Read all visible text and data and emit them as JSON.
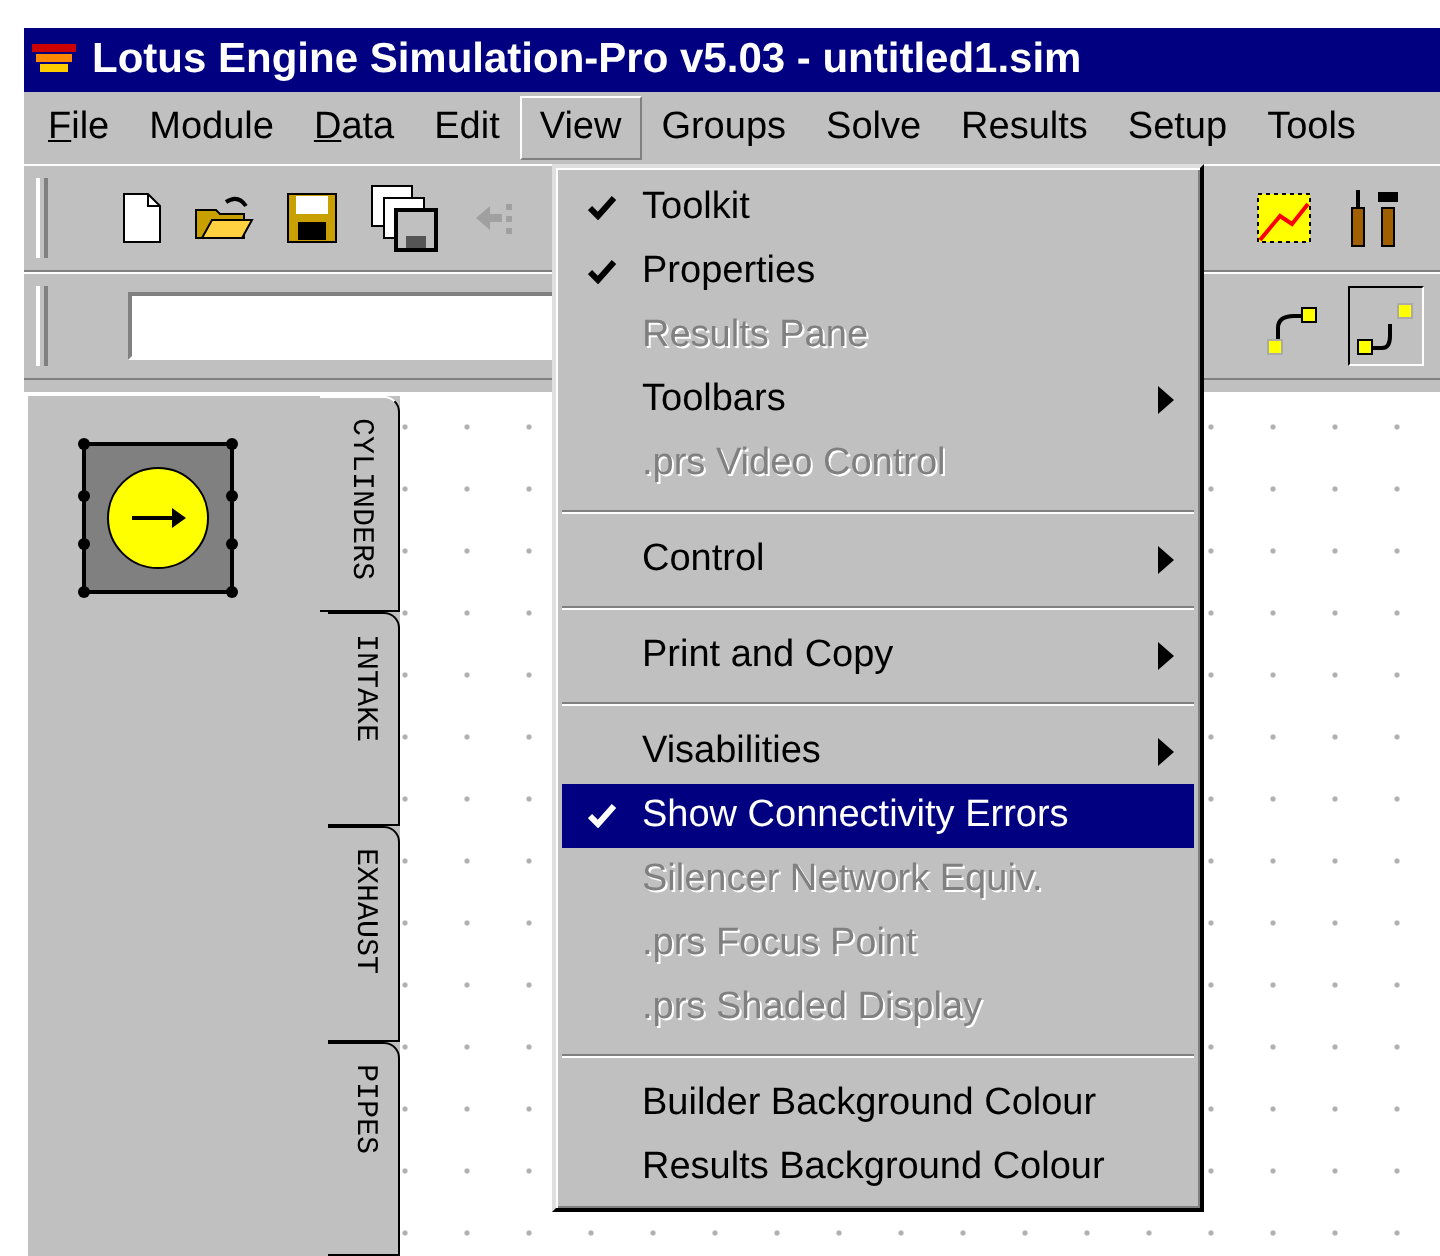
{
  "window": {
    "title": "Lotus Engine Simulation-Pro v5.03 - untitled1.sim"
  },
  "menubar": [
    {
      "label": "File",
      "underline_first": true,
      "selected": false
    },
    {
      "label": "Module",
      "underline_first": false,
      "selected": false
    },
    {
      "label": "Data",
      "underline_first": true,
      "selected": false
    },
    {
      "label": "Edit",
      "underline_first": false,
      "selected": false
    },
    {
      "label": "View",
      "underline_first": false,
      "selected": true
    },
    {
      "label": "Groups",
      "underline_first": false,
      "selected": false
    },
    {
      "label": "Solve",
      "underline_first": false,
      "selected": false
    },
    {
      "label": "Results",
      "underline_first": false,
      "selected": false
    },
    {
      "label": "Setup",
      "underline_first": false,
      "selected": false
    },
    {
      "label": "Tools",
      "underline_first": false,
      "selected": false
    }
  ],
  "view_menu": [
    {
      "kind": "item",
      "label": "Toolkit",
      "checked": true,
      "disabled": false,
      "submenu": false,
      "selected": false
    },
    {
      "kind": "item",
      "label": "Properties",
      "checked": true,
      "disabled": false,
      "submenu": false,
      "selected": false
    },
    {
      "kind": "item",
      "label": "Results Pane",
      "checked": false,
      "disabled": true,
      "submenu": false,
      "selected": false
    },
    {
      "kind": "item",
      "label": "Toolbars",
      "checked": false,
      "disabled": false,
      "submenu": true,
      "selected": false
    },
    {
      "kind": "item",
      "label": ".prs Video Control",
      "checked": false,
      "disabled": true,
      "submenu": false,
      "selected": false
    },
    {
      "kind": "separator"
    },
    {
      "kind": "item",
      "label": "Control",
      "checked": false,
      "disabled": false,
      "submenu": true,
      "selected": false
    },
    {
      "kind": "separator"
    },
    {
      "kind": "item",
      "label": "Print and Copy",
      "checked": false,
      "disabled": false,
      "submenu": true,
      "selected": false
    },
    {
      "kind": "separator"
    },
    {
      "kind": "item",
      "label": "Visabilities",
      "checked": false,
      "disabled": false,
      "submenu": true,
      "selected": false
    },
    {
      "kind": "item",
      "label": "Show Connectivity Errors",
      "checked": true,
      "disabled": false,
      "submenu": false,
      "selected": true
    },
    {
      "kind": "item",
      "label": "Silencer Network Equiv.",
      "checked": false,
      "disabled": true,
      "submenu": false,
      "selected": false
    },
    {
      "kind": "item",
      "label": ".prs Focus Point",
      "checked": false,
      "disabled": true,
      "submenu": false,
      "selected": false
    },
    {
      "kind": "item",
      "label": ".prs Shaded Display",
      "checked": false,
      "disabled": true,
      "submenu": false,
      "selected": false
    },
    {
      "kind": "separator"
    },
    {
      "kind": "item",
      "label": "Builder Background Colour",
      "checked": false,
      "disabled": false,
      "submenu": false,
      "selected": false
    },
    {
      "kind": "item",
      "label": "Results Background Colour",
      "checked": false,
      "disabled": false,
      "submenu": false,
      "selected": false
    }
  ],
  "toolkit_tabs": [
    {
      "label": "CYLINDERS",
      "selected": true
    },
    {
      "label": "INTAKE",
      "selected": false
    },
    {
      "label": "EXHAUST",
      "selected": false
    },
    {
      "label": "PIPES",
      "selected": false
    }
  ]
}
